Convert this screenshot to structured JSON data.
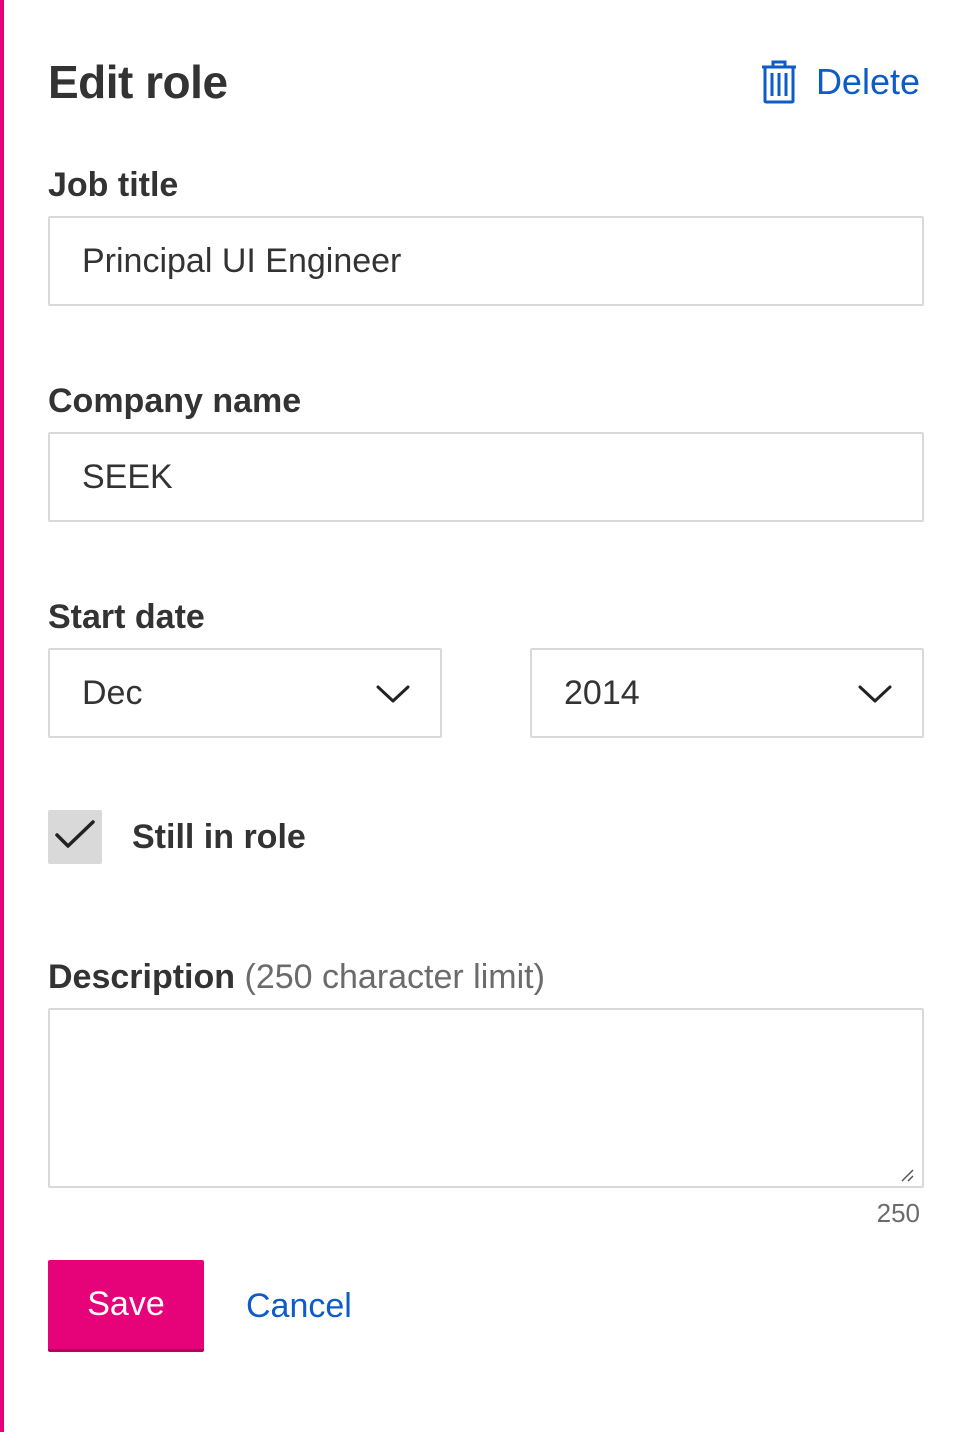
{
  "header": {
    "title": "Edit role",
    "delete_label": "Delete",
    "delete_icon": "trash-icon"
  },
  "form": {
    "job_title": {
      "label": "Job title",
      "value": "Principal UI Engineer"
    },
    "company_name": {
      "label": "Company name",
      "value": "SEEK"
    },
    "start_date": {
      "label": "Start date",
      "month": "Dec",
      "year": "2014"
    },
    "still_in_role": {
      "label": "Still in role",
      "checked": true
    },
    "description": {
      "label": "Description",
      "hint": "(250 character limit)",
      "value": "",
      "remaining": "250"
    }
  },
  "actions": {
    "save_label": "Save",
    "cancel_label": "Cancel"
  },
  "colors": {
    "accent": "#e60278",
    "link": "#0d5cc7",
    "text": "#333333",
    "border": "#d9d9d9"
  }
}
